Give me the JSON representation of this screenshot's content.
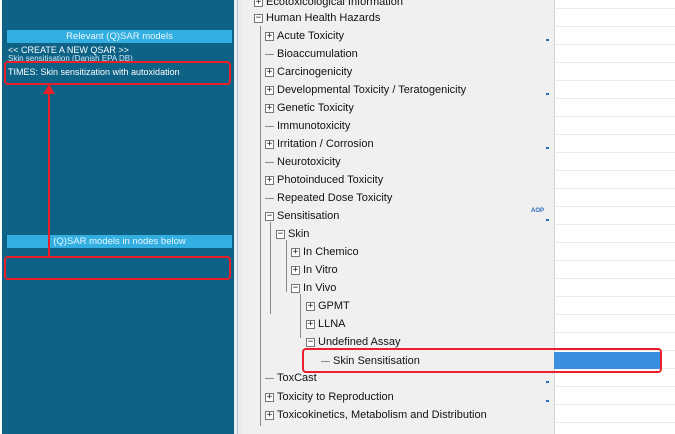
{
  "left_panel": {
    "relevant_header": "Relevant (Q)SAR models",
    "qsar_items": [
      "<< CREATE A NEW QSAR >>",
      "Skin sensitisation (Danish EPA DB)",
      "TIMES: Skin sensitization with autoxidation"
    ],
    "nodes_header": "(Q)SAR models in nodes below"
  },
  "tree": {
    "items": [
      {
        "label": "Ecotoxicological Information",
        "expander": "+"
      },
      {
        "label": "Human Health Hazards",
        "expander": "−"
      },
      {
        "label": "Acute Toxicity",
        "expander": "+"
      },
      {
        "label": "Bioaccumulation",
        "expander": ""
      },
      {
        "label": "Carcinogenicity",
        "expander": "+"
      },
      {
        "label": "Developmental Toxicity / Teratogenicity",
        "expander": "+"
      },
      {
        "label": "Genetic Toxicity",
        "expander": "+"
      },
      {
        "label": "Immunotoxicity",
        "expander": ""
      },
      {
        "label": "Irritation / Corrosion",
        "expander": "+"
      },
      {
        "label": "Neurotoxicity",
        "expander": ""
      },
      {
        "label": "Photoinduced Toxicity",
        "expander": "+"
      },
      {
        "label": "Repeated Dose Toxicity",
        "expander": ""
      },
      {
        "label": "Sensitisation",
        "expander": "−"
      },
      {
        "label": "Skin",
        "expander": "−"
      },
      {
        "label": "In Chemico",
        "expander": "+"
      },
      {
        "label": "In Vitro",
        "expander": "+"
      },
      {
        "label": "In Vivo",
        "expander": "−"
      },
      {
        "label": "GPMT",
        "expander": "+"
      },
      {
        "label": "LLNA",
        "expander": "+"
      },
      {
        "label": "Undefined Assay",
        "expander": "−"
      },
      {
        "label": "Skin Sensitisation",
        "expander": ""
      },
      {
        "label": "ToxCast",
        "expander": ""
      },
      {
        "label": "Toxicity to Reproduction",
        "expander": "+"
      },
      {
        "label": "Toxicokinetics, Metabolism and Distribution",
        "expander": "+"
      }
    ],
    "aop_badge": "AOP"
  },
  "colors": {
    "panel_bg": "#0d6286",
    "header_bg": "#33aee0",
    "annotation_red": "#e8202a",
    "selected_cell": "#3a8fe0"
  }
}
